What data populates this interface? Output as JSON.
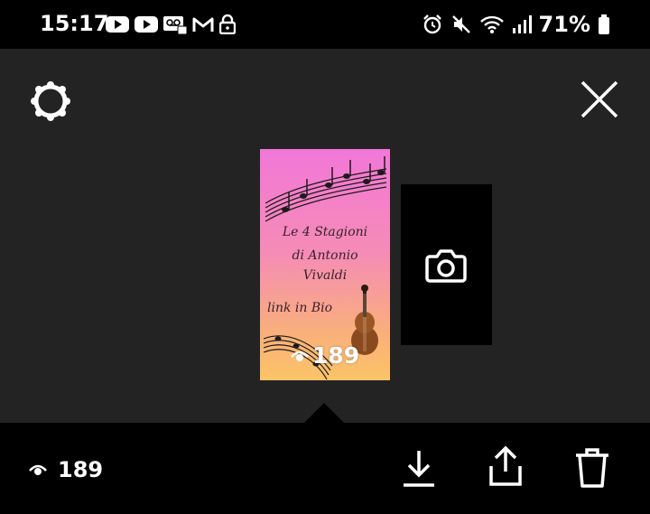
{
  "statusbar": {
    "time": "15:17",
    "battery_percent": "71%",
    "left_icons": [
      "youtube-icon",
      "youtube-icon",
      "voicemail-icon",
      "gmail-icon",
      "lock-icon"
    ],
    "right_icons": [
      "alarm-icon",
      "mute-icon",
      "wifi-icon",
      "signal-icon",
      "battery-icon"
    ]
  },
  "story": {
    "thumbnail_lines": [
      "Le 4 Stagioni",
      "di Antonio",
      "Vivaldi",
      "link in Bio"
    ],
    "thumbnail_views": "189"
  },
  "bottom": {
    "views": "189"
  },
  "colors": {
    "background": "#232323",
    "bar": "#000000",
    "icon": "#ffffff"
  }
}
